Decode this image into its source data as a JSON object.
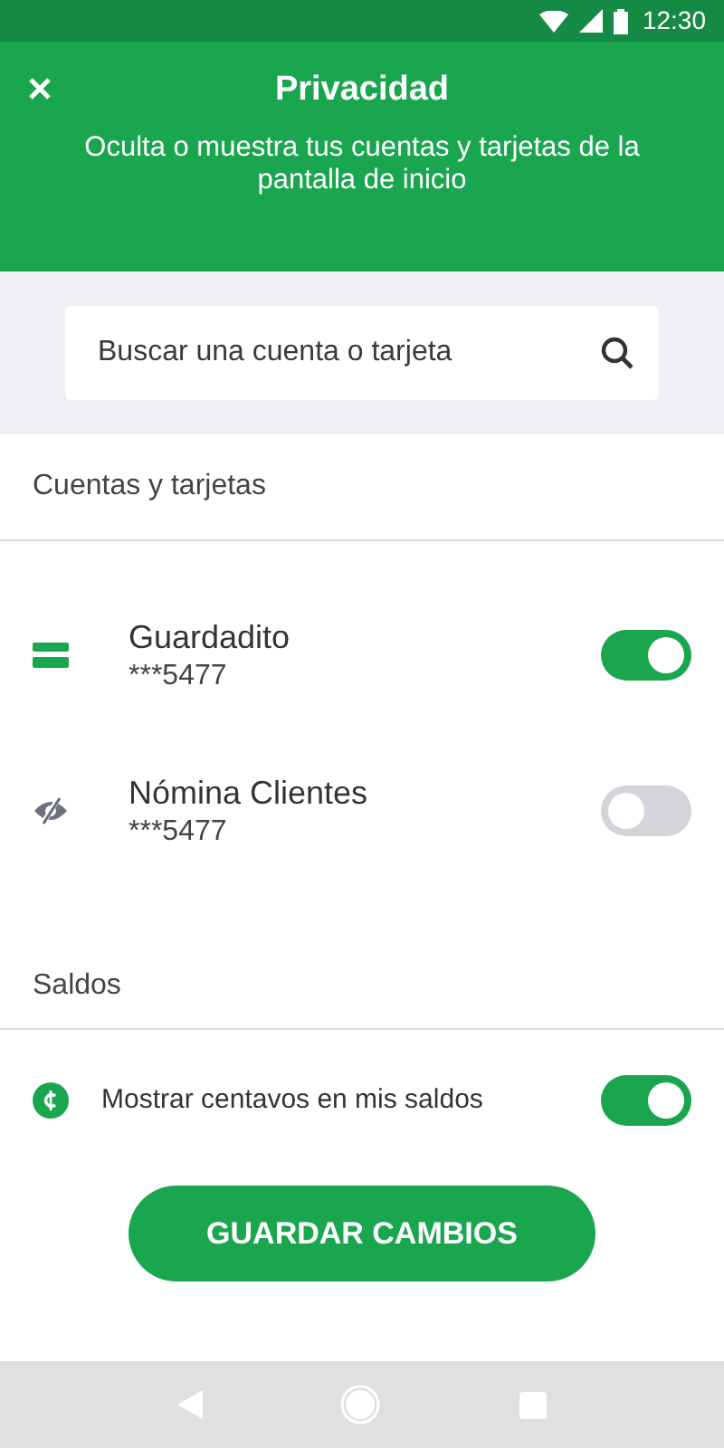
{
  "status_bar": {
    "time": "12:30"
  },
  "header": {
    "title": "Privacidad",
    "subtitle": "Oculta o muestra tus cuentas y tarjetas de la pantalla de inicio"
  },
  "search": {
    "placeholder": "Buscar una cuenta o tarjeta"
  },
  "accounts_section": {
    "title": "Cuentas y tarjetas",
    "items": [
      {
        "name": "Guardadito",
        "number": "***5477",
        "on": true
      },
      {
        "name": "Nómina Clientes",
        "number": "***5477",
        "on": false
      }
    ]
  },
  "balances_section": {
    "title": "Saldos",
    "items": [
      {
        "label": "Mostrar centavos en mis saldos",
        "on": true
      }
    ]
  },
  "save_button": "GUARDAR CAMBIOS"
}
